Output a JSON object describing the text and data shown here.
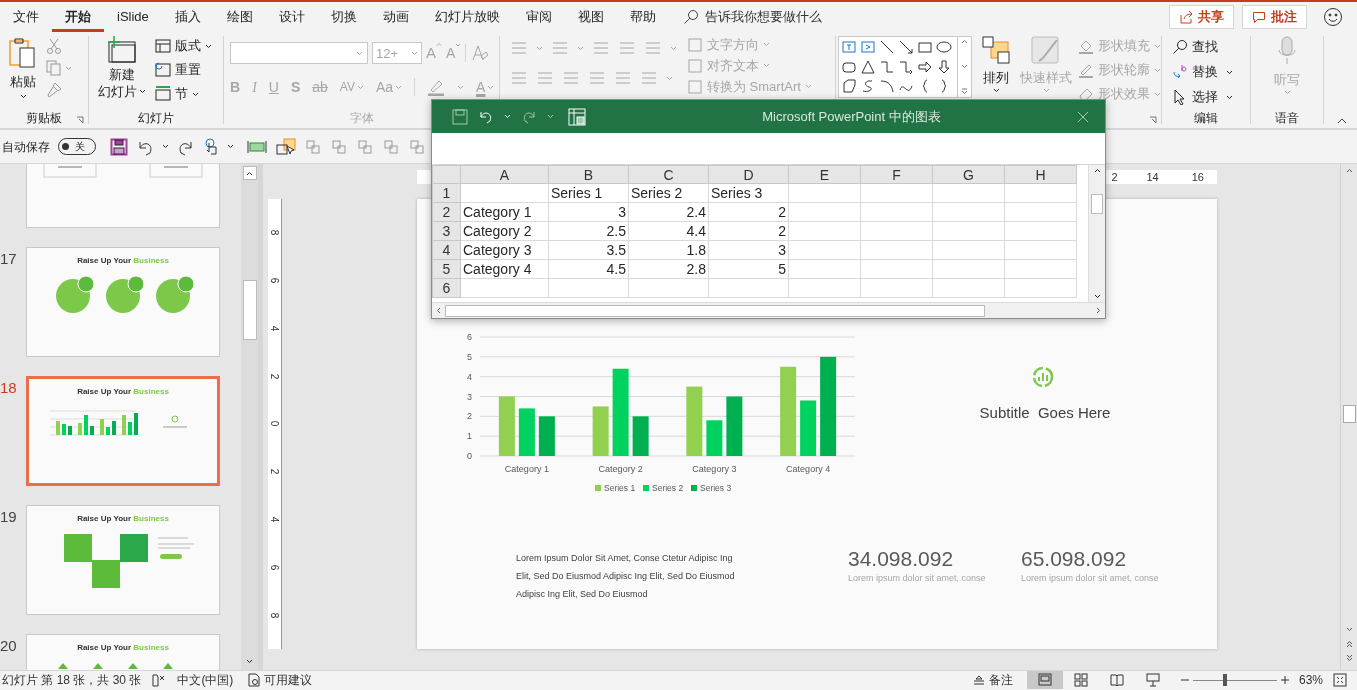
{
  "menu_tabs": [
    {
      "label": "文件",
      "selected": false
    },
    {
      "label": "开始",
      "selected": true
    },
    {
      "label": "iSlide",
      "selected": false
    },
    {
      "label": "插入",
      "selected": false
    },
    {
      "label": "绘图",
      "selected": false
    },
    {
      "label": "设计",
      "selected": false
    },
    {
      "label": "切换",
      "selected": false
    },
    {
      "label": "动画",
      "selected": false
    },
    {
      "label": "幻灯片放映",
      "selected": false
    },
    {
      "label": "审阅",
      "selected": false
    },
    {
      "label": "视图",
      "selected": false
    },
    {
      "label": "帮助",
      "selected": false
    }
  ],
  "tell_me": {
    "placeholder": "告诉我你想要做什么"
  },
  "header_buttons": [
    {
      "label": "共享"
    },
    {
      "label": "批注"
    }
  ],
  "ribbon": {
    "clipboard": {
      "label": "剪贴板",
      "paste": "粘贴"
    },
    "slides": {
      "label": "幻灯片",
      "new_slide": [
        "新建",
        "幻灯片"
      ],
      "items": [
        "版式",
        "重置",
        "节"
      ]
    },
    "font": {
      "label": "字体",
      "disabled": true,
      "size": "12+",
      "grow": "A",
      "shrink": "A",
      "formats": [
        "B",
        "I",
        "U",
        "S",
        "ab",
        "AV",
        "Aa"
      ],
      "color_letter": "A"
    },
    "paragraph": {
      "disabled": true,
      "items": [
        "文字方向",
        "对齐文本",
        "转换为 SmartArt"
      ]
    },
    "drawing": {
      "arrange": {
        "label": "排列",
        "disabled": false
      },
      "quick_styles": {
        "label": "快速样式",
        "disabled": true
      },
      "shape_format": [
        {
          "label": "形状填充",
          "disabled": true
        },
        {
          "label": "形状轮廓",
          "disabled": true
        },
        {
          "label": "形状效果",
          "disabled": true
        }
      ]
    },
    "editing": {
      "label": "编辑",
      "items": [
        {
          "label": "查找"
        },
        {
          "label": "替换"
        },
        {
          "label": "选择"
        }
      ]
    },
    "voice": {
      "label": "语音",
      "dictate": {
        "label": "听写",
        "disabled": true
      }
    }
  },
  "quick_access": {
    "autosave_label": "自动保存",
    "autosave": {
      "on": false,
      "label": "关"
    }
  },
  "thumbnails": [
    {
      "selected": false,
      "kind": "boxes"
    },
    {
      "number": "17",
      "selected": false,
      "kind": "circles",
      "title": "Raise Up Your ",
      "title_accent": "Business"
    },
    {
      "number": "18",
      "selected": true,
      "kind": "chart",
      "title": "Raise Up Your ",
      "title_accent": "Business"
    },
    {
      "number": "19",
      "selected": false,
      "kind": "squares",
      "title": "Raise Up Your ",
      "title_accent": "Business"
    },
    {
      "number": "20",
      "selected": false,
      "kind": "arrows",
      "title": "Raise Up Your ",
      "title_accent": "Business"
    }
  ],
  "ruler": {
    "top_labels": [
      "2",
      "14",
      "16"
    ],
    "side_labels": [
      "8",
      "6",
      "4",
      "2",
      "0",
      "2",
      "4",
      "6",
      "8"
    ]
  },
  "excel": {
    "title": "Microsoft PowerPoint 中的图表",
    "columns": [
      "A",
      "B",
      "C",
      "D",
      "E",
      "F",
      "G",
      "H"
    ],
    "rows": [
      {
        "header": "1",
        "cells": [
          "",
          "Series 1",
          "Series 2",
          "Series 3"
        ]
      },
      {
        "header": "2",
        "cells": [
          "Category 1",
          "3",
          "2.4",
          "2"
        ]
      },
      {
        "header": "3",
        "cells": [
          "Category 2",
          "2.5",
          "4.4",
          "2"
        ]
      },
      {
        "header": "4",
        "cells": [
          "Category 3",
          "3.5",
          "1.8",
          "3"
        ]
      },
      {
        "header": "5",
        "cells": [
          "Category 4",
          "4.5",
          "2.8",
          "5"
        ]
      },
      {
        "header": "6",
        "cells": []
      }
    ]
  },
  "slide": {
    "chart_data": {
      "type": "bar",
      "categories": [
        "Category 1",
        "Category 2",
        "Category 3",
        "Category 4"
      ],
      "series": [
        {
          "name": "Series 1",
          "color": "#92d050",
          "values": [
            3,
            2.5,
            3.5,
            4.5
          ]
        },
        {
          "name": "Series 2",
          "color": "#00d25f",
          "values": [
            2.4,
            4.4,
            1.8,
            2.8
          ]
        },
        {
          "name": "Series 3",
          "color": "#00b050",
          "values": [
            2,
            2,
            3,
            5
          ]
        }
      ],
      "ylim": [
        0,
        6
      ],
      "yticks": [
        0,
        1,
        2,
        3,
        4,
        5,
        6
      ],
      "grid": true,
      "legend": true
    },
    "subtitle": "Subtitle  Goes Here",
    "body": "Lorem Ipsum Dolor Sit Amet, Conse Ctetur Adipisc Ing Elit, Sed Do Eiusmod Adipisc Ing Elit, Sed Do Eiusmod Adipisc Ing Elit, Sed Do Eiusmod",
    "stats": [
      {
        "value": "34.098.092",
        "caption": "Lorem ipsum dolor sit amet, conse"
      },
      {
        "value": "65.098.092",
        "caption": "Lorem ipsum dolor sit amet, conse"
      }
    ]
  },
  "status_bar": {
    "slide_info": "幻灯片 第 18 张，共 30 张",
    "language": "中文(中国)",
    "suggestions": "可用建议",
    "notes": "备注",
    "views": [
      {
        "selected": true
      },
      {
        "selected": false
      },
      {
        "selected": false
      },
      {
        "selected": false
      }
    ],
    "zoom": {
      "level": 0.38,
      "label": "63%"
    }
  }
}
